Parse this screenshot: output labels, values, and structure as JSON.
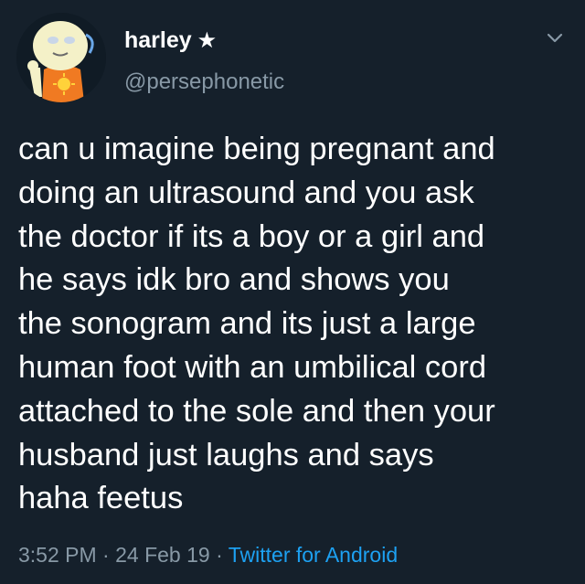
{
  "user": {
    "display_name": "harley",
    "badge": "★",
    "handle": "@persephonetic"
  },
  "tweet": {
    "text": "can u imagine being pregnant and\ndoing an ultrasound and you ask\nthe doctor if its a boy or a girl and\nhe says idk bro and shows you\nthe sonogram and its just a large\nhuman foot with an umbilical cord\nattached to the sole and then your\nhusband just laughs and says\nhaha feetus",
    "time": "3:52 PM",
    "separator": "·",
    "date": "24 Feb 19",
    "source": "Twitter for Android"
  },
  "colors": {
    "background": "#15202b",
    "text_primary": "#ffffff",
    "text_secondary": "#8899a6",
    "link": "#1da1f2"
  },
  "icons": {
    "menu": "chevron-down-icon",
    "avatar": "avatar-illustration"
  }
}
